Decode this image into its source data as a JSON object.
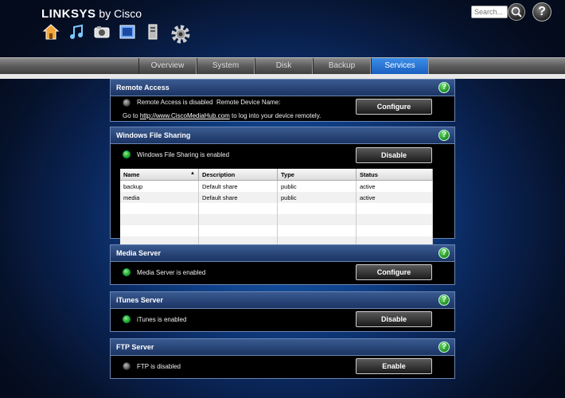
{
  "header": {
    "brand": "LINKSYS",
    "brand_suffix": "by Cisco",
    "search_placeholder": "Search...",
    "help_glyph": "?",
    "nav_icons": [
      "home-icon",
      "music-icon",
      "photo-icon",
      "video-icon",
      "storage-icon",
      "gear-icon"
    ]
  },
  "tabs": [
    "Overview",
    "System",
    "Disk",
    "Backup",
    "Services"
  ],
  "active_tab": "Services",
  "panels": {
    "remote_access": {
      "title": "Remote Access",
      "status": "Remote Access is disabled",
      "device_name_label": "Remote Device Name:",
      "goto_prefix": "Go to",
      "goto_link": "http://www.CiscoMediaHub.com",
      "goto_suffix": "to log into your device remotely.",
      "button": "Configure"
    },
    "windows_file_sharing": {
      "title": "Windows File Sharing",
      "status": "Windows File Sharing is enabled",
      "button": "Disable",
      "columns": [
        "Name",
        "Description",
        "Type",
        "Status"
      ],
      "rows": [
        [
          "backup",
          "Default share",
          "public",
          "active"
        ],
        [
          "media",
          "Default share",
          "public",
          "active"
        ]
      ]
    },
    "media_server": {
      "title": "Media Server",
      "status": "Media Server is enabled",
      "button": "Configure"
    },
    "itunes_server": {
      "title": "iTunes Server",
      "status": "iTunes is enabled",
      "button": "Disable"
    },
    "ftp_server": {
      "title": "FTP Server",
      "status": "FTP is disabled",
      "button": "Enable"
    }
  },
  "colors": {
    "accent": "#1a5fc0",
    "led_on": "#1aa01a",
    "led_off": "#777777"
  }
}
